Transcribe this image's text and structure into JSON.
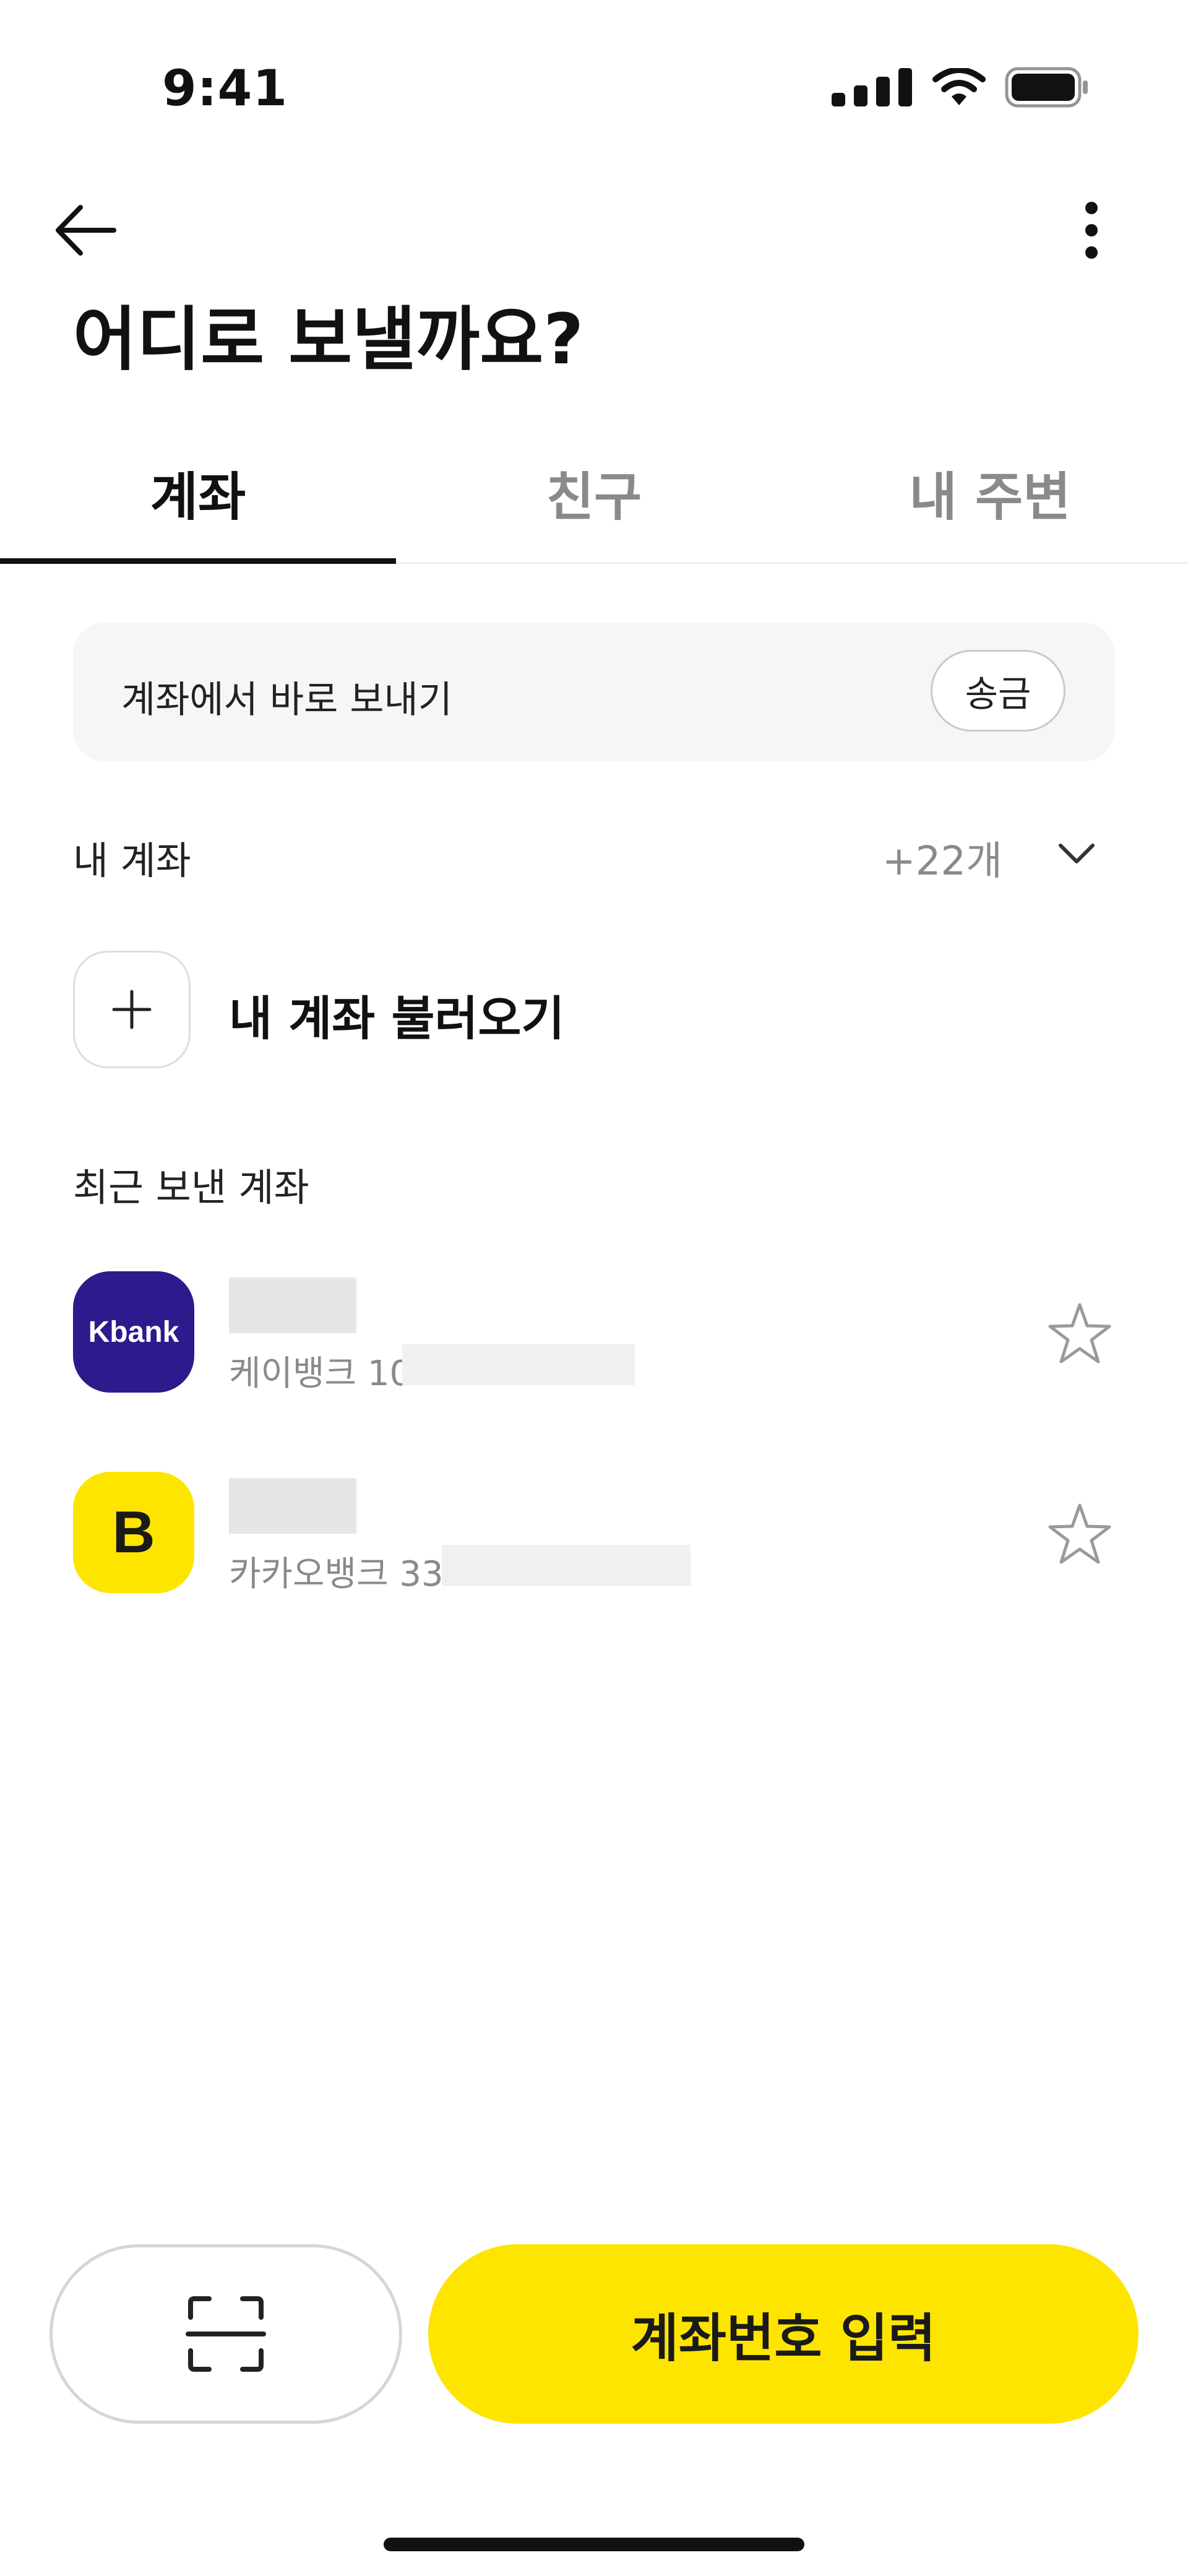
{
  "status_bar": {
    "time": "9:41"
  },
  "header": {
    "back_icon": "arrow-left-icon",
    "more_icon": "more-vertical-icon",
    "title": "어디로 보낼까요?"
  },
  "tabs": [
    {
      "label": "계좌",
      "active": true
    },
    {
      "label": "친구",
      "active": false
    },
    {
      "label": "내 주변",
      "active": false
    }
  ],
  "quick_send": {
    "text": "계좌에서 바로 보내기",
    "button_label": "송금"
  },
  "my_accounts": {
    "label": "내 계좌",
    "count": "+22개",
    "add_label": "내 계좌 불러오기"
  },
  "recent": {
    "label": "최근 보낸 계좌",
    "items": [
      {
        "bank_logo_text": "Kbank",
        "account_prefix": "케이뱅크 10",
        "logo_color": "#2d1a8c",
        "favorite": false
      },
      {
        "bank_logo_text": "B",
        "account_prefix": "카카오뱅크 33",
        "logo_color": "#fee500",
        "favorite": false
      }
    ]
  },
  "bottom": {
    "scan_icon": "scan-icon",
    "primary_label": "계좌번호 입력",
    "primary_color": "#fee500"
  }
}
